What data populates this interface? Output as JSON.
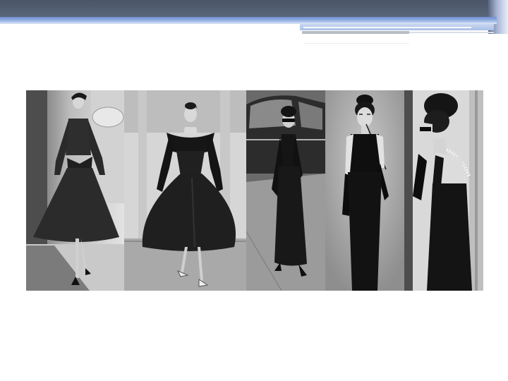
{
  "slide": {
    "accent_colors": {
      "header_bar": "#4a5568",
      "rule_blue": "#6d8fd0",
      "rule_gray": "#b8bcc4"
    }
  },
  "gallery": {
    "description_icons": [
      "photo-1-woman-in-full-skirt-coat-dress",
      "photo-2-off-shoulder-ball-gown",
      "photo-3-black-dress-with-car",
      "photo-4-little-black-dress-portrait",
      "photo-5-black-dress-back-view-sunglasses"
    ],
    "photo_count": 5
  }
}
